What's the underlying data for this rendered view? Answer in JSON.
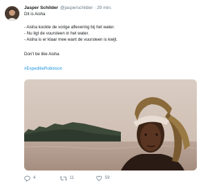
{
  "tweet": {
    "author_name": "Jasper Schilder",
    "handle": "@jasperschilder",
    "separator": "·",
    "time": "29 min.",
    "lines": [
      "Dit is Aisha",
      "- Aisha kookte de vorige aflevering bij het water.",
      "- Nu ligt de vuursteen in het water.",
      "- Aisha is er klaar mee want de vuursteen is kwijt.",
      "Don't be like Aisha"
    ],
    "hashtag": "#ExpeditieRobinson",
    "actions": {
      "reply_count": "4",
      "retweet_count": "11",
      "like_count": "59"
    }
  },
  "colors": {
    "link": "#1b95e0",
    "secondary_text": "#657786",
    "primary_text": "#14171a"
  },
  "icons": [
    "reply-icon",
    "retweet-icon",
    "like-icon"
  ]
}
